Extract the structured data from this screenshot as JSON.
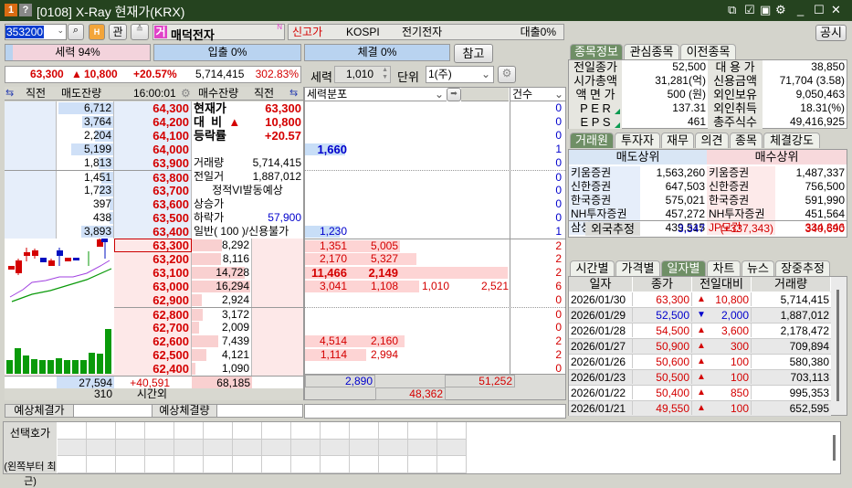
{
  "title": {
    "badge1": "1",
    "badge2": "?",
    "text": "[0108] X-Ray 현재가(KRX)"
  },
  "toolbar": {
    "code": "353200",
    "kwan": "관",
    "stock_badge": "거",
    "stock_name": "매덕전자",
    "n_mark": "N",
    "tags": [
      "신고가",
      "KOSPI",
      "전기전자",
      "대출0%"
    ],
    "notice_button": "공시"
  },
  "ratios": {
    "force": "세력 94%",
    "force_value": 94,
    "inout": "입출 0%",
    "trade": "체결 0%",
    "ref_button": "참고"
  },
  "summary": {
    "price": "63,300",
    "arrow": "▲",
    "change": "10,800",
    "rate": "+20.57%",
    "volume": "5,714,415",
    "turnover": "302.83%",
    "force_label": "세력",
    "force_value": "1,010",
    "unit_label": "단위",
    "unit_value": "1(주)"
  },
  "orderbook": {
    "headers": {
      "prev1": "직전",
      "ask_qty": "매도잔량",
      "time": "16:00:01",
      "bid_qty": "매수잔량",
      "prev2": "직전"
    },
    "asks": [
      {
        "qty": "6,712",
        "price": "64,300"
      },
      {
        "qty": "3,764",
        "price": "64,200"
      },
      {
        "qty": "2,204",
        "price": "64,100"
      },
      {
        "qty": "5,199",
        "price": "64,000"
      },
      {
        "qty": "1,813",
        "price": "63,900"
      },
      {
        "qty": "1,451",
        "price": "63,800"
      },
      {
        "qty": "1,723",
        "price": "63,700"
      },
      {
        "qty": "397",
        "price": "63,600"
      },
      {
        "qty": "438",
        "price": "63,500"
      },
      {
        "qty": "3,893",
        "price": "63,400"
      }
    ],
    "bids": [
      {
        "price": "63,300",
        "qty": "8,292"
      },
      {
        "price": "63,200",
        "qty": "8,116"
      },
      {
        "price": "63,100",
        "qty": "14,728"
      },
      {
        "price": "63,000",
        "qty": "16,294"
      },
      {
        "price": "62,900",
        "qty": "2,924"
      },
      {
        "price": "62,800",
        "qty": "3,172"
      },
      {
        "price": "62,700",
        "qty": "2,009"
      },
      {
        "price": "62,600",
        "qty": "7,439"
      },
      {
        "price": "62,500",
        "qty": "4,121"
      },
      {
        "price": "62,400",
        "qty": "1,090"
      }
    ],
    "total_ask": "27,594",
    "total_diff": "+40,591",
    "total_bid": "68,185",
    "after_hours_qty": "310",
    "after_hours_label": "시간외",
    "info": [
      {
        "label": "현재가",
        "value": "63,300",
        "cls": "red bold big"
      },
      {
        "label": "대  비  ▲",
        "value": "10,800",
        "cls": "red bold big"
      },
      {
        "label": "등락률",
        "value": "+20.57",
        "cls": "red bold big"
      },
      {
        "label": "",
        "value": "",
        "cls": ""
      },
      {
        "label": "거래량",
        "value": "5,714,415",
        "cls": ""
      },
      {
        "label": "전일거",
        "value": "1,887,012",
        "cls": ""
      },
      {
        "label": "정적VI발동예상",
        "value": "",
        "cls": "center"
      },
      {
        "label": "상승가",
        "value": "",
        "cls": ""
      },
      {
        "label": "하락가",
        "value": "57,900",
        "cls": "blue"
      },
      {
        "label": "일반( 100 )/신용불가",
        "value": "",
        "cls": ""
      }
    ]
  },
  "expected": {
    "price_label": "예상체결가",
    "price": "",
    "qty_label": "예상체결량",
    "qty": ""
  },
  "distribution": {
    "select": "세력분포",
    "count_select": "건수",
    "rows": [
      {
        "v": [],
        "n": "0"
      },
      {
        "v": [],
        "n": "0"
      },
      {
        "v": [],
        "n": "0"
      },
      {
        "v": [
          "1,660"
        ],
        "n": "1",
        "bold": true
      },
      {
        "v": [],
        "n": "0"
      },
      {
        "v": [],
        "n": "0"
      },
      {
        "v": [],
        "n": "0"
      },
      {
        "v": [],
        "n": "0"
      },
      {
        "v": [],
        "n": "0"
      },
      {
        "v": [
          "1,230"
        ],
        "n": "1"
      },
      {
        "v": [
          "1,351",
          "5,005"
        ],
        "n": "2"
      },
      {
        "v": [
          "2,170",
          "5,327"
        ],
        "n": "2"
      },
      {
        "v": [
          "11,466",
          "2,149"
        ],
        "n": "2",
        "bold": true
      },
      {
        "v": [
          "3,041",
          "1,108",
          "1,010",
          "2,521"
        ],
        "n": "6"
      },
      {
        "v": [],
        "n": "0"
      },
      {
        "v": [],
        "n": "0"
      },
      {
        "v": [],
        "n": "0"
      },
      {
        "v": [
          "4,514",
          "2,160"
        ],
        "n": "2"
      },
      {
        "v": [
          "1,114",
          "2,994"
        ],
        "n": "2"
      },
      {
        "v": [],
        "n": "0"
      }
    ],
    "total_sell": "2,890",
    "total_buy": "51,252",
    "net": "48,362"
  },
  "stock_info": {
    "tabs": [
      "종목정보",
      "관심종목",
      "이전종목"
    ],
    "rows": [
      [
        "전일종가",
        "52,500",
        "대 용 가",
        "38,850"
      ],
      [
        "시가총액",
        "31,281(억)",
        "신용금액",
        "71,704  (3.58)"
      ],
      [
        "액 면 가",
        "500 (원)",
        "외인보유",
        "9,050,463"
      ],
      [
        "P E R",
        "137.31",
        "외인취득",
        "18.31(%)"
      ],
      [
        "E P S",
        "461",
        "총주식수",
        "49,416,925"
      ]
    ]
  },
  "brokers": {
    "tabs": [
      "거래원",
      "투자자",
      "재무",
      "의견",
      "종목",
      "체결강도"
    ],
    "sell_header": "매도상위",
    "buy_header": "매수상위",
    "rows": [
      [
        "키움증권",
        "1,563,260",
        "키움증권",
        "1,487,337"
      ],
      [
        "신한증권",
        "647,503",
        "신한증권",
        "756,500"
      ],
      [
        "한국증권",
        "575,021",
        "한국증권",
        "591,990"
      ],
      [
        "NH투자증권",
        "457,272",
        "NH투자증권",
        "451,564"
      ],
      [
        "삼성증권",
        "439,515",
        "JP모간",
        "334,846"
      ]
    ],
    "foreign_label": "외국추정",
    "foreign_sell": "3,347",
    "foreign_diff": "(+337,343)",
    "foreign_buy": "340,690"
  },
  "daily": {
    "tabs": [
      "시간별",
      "가격별",
      "일자별",
      "차트",
      "뉴스",
      "장중추정"
    ],
    "headers": [
      "일자",
      "종가",
      "전일대비",
      "거래량"
    ],
    "rows": [
      [
        "2026/01/30",
        "63,300",
        "▲",
        "10,800",
        "5,714,415",
        "up"
      ],
      [
        "2026/01/29",
        "52,500",
        "▼",
        "2,000",
        "1,887,012",
        "down"
      ],
      [
        "2026/01/28",
        "54,500",
        "▲",
        "3,600",
        "2,178,472",
        "up"
      ],
      [
        "2026/01/27",
        "50,900",
        "▲",
        "300",
        "709,894",
        "up"
      ],
      [
        "2026/01/26",
        "50,600",
        "▲",
        "100",
        "580,380",
        "up"
      ],
      [
        "2026/01/23",
        "50,500",
        "▲",
        "100",
        "703,113",
        "up"
      ],
      [
        "2026/01/22",
        "50,400",
        "▲",
        "850",
        "995,353",
        "up"
      ],
      [
        "2026/01/21",
        "49,550",
        "▲",
        "100",
        "652,595",
        "up"
      ]
    ]
  },
  "bottom": {
    "label1": "선택호가",
    "label2": "(왼쪽부터 최근)"
  },
  "colors": {
    "up": "#d40000",
    "down": "#0000cc",
    "title_bg": "#25431f",
    "ask_bg": "#e6eefa",
    "bid_bg": "#fde8e8"
  }
}
